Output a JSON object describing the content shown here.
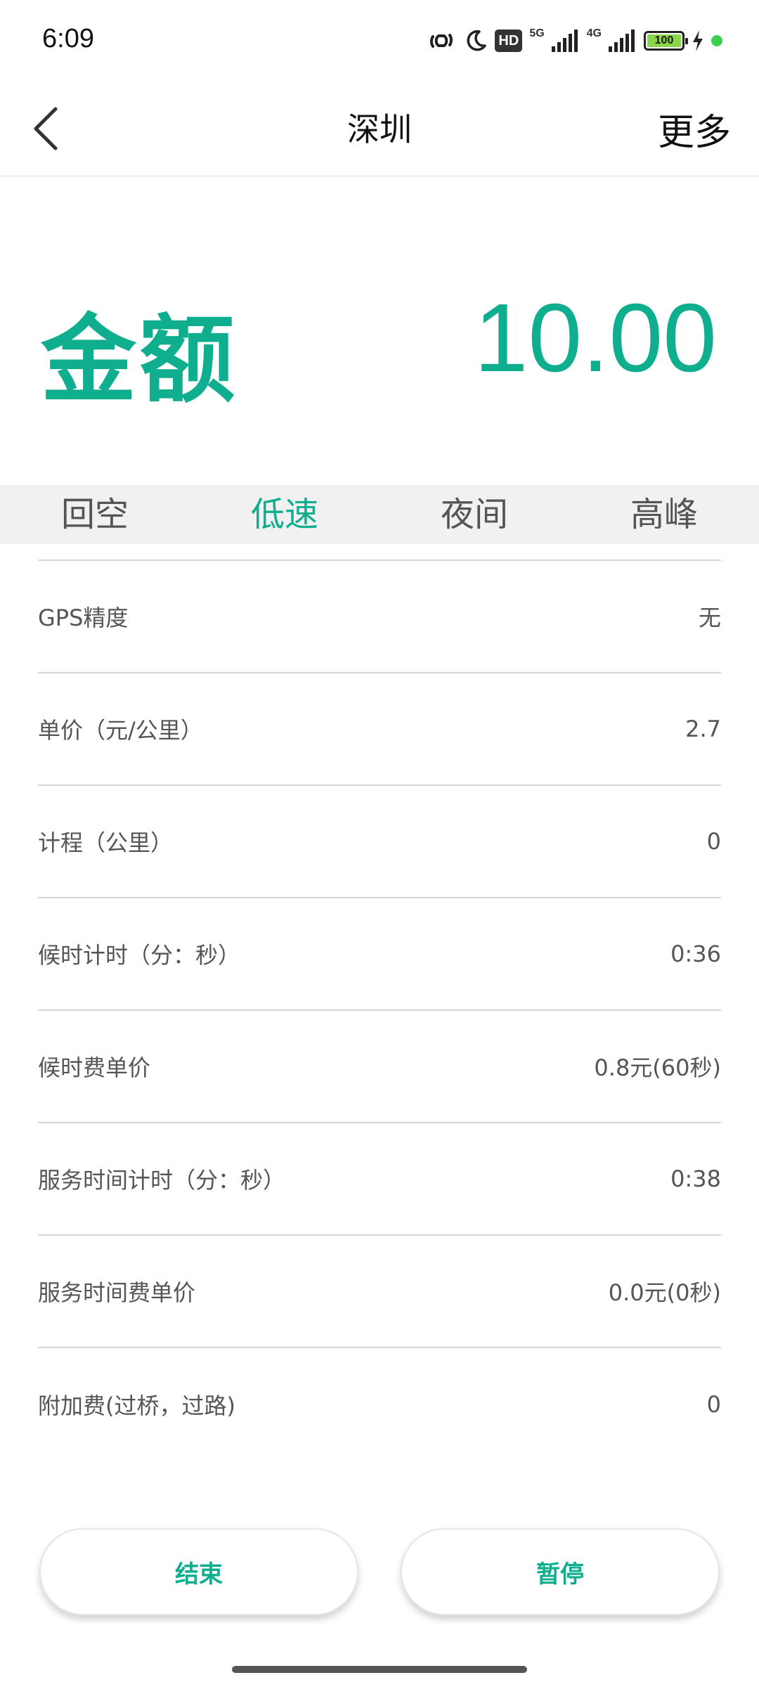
{
  "status_bar": {
    "time": "6:09",
    "hd": "HD",
    "net_5g": "5G",
    "net_4g": "4G",
    "battery": "100"
  },
  "nav": {
    "title": "深圳",
    "more": "更多"
  },
  "amount": {
    "label": "金额",
    "value": "10.00"
  },
  "tabs": [
    {
      "label": "回空",
      "active": false
    },
    {
      "label": "低速",
      "active": true
    },
    {
      "label": "夜间",
      "active": false
    },
    {
      "label": "高峰",
      "active": false
    }
  ],
  "rows": [
    {
      "label": "GPS精度",
      "value": "无"
    },
    {
      "label": "单价（元/公里）",
      "value": "2.7"
    },
    {
      "label": "计程（公里）",
      "value": "0"
    },
    {
      "label": "候时计时（分：秒）",
      "value": "0:36"
    },
    {
      "label": "候时费单价",
      "value": "0.8元(60秒)"
    },
    {
      "label": "服务时间计时（分：秒）",
      "value": "0:38"
    },
    {
      "label": "服务时间费单价",
      "value": "0.0元(0秒)"
    },
    {
      "label": "附加费(过桥，过路)",
      "value": "0"
    }
  ],
  "buttons": {
    "end": "结束",
    "pause": "暂停"
  },
  "colors": {
    "accent": "#0eae8f"
  }
}
